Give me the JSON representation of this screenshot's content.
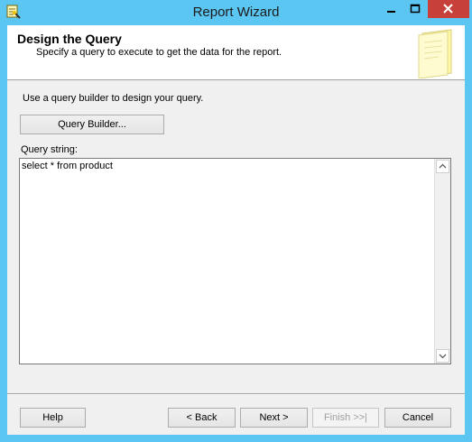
{
  "window": {
    "title": "Report Wizard"
  },
  "header": {
    "title": "Design the Query",
    "subtitle": "Specify a query to execute to get the data for the report."
  },
  "body": {
    "instruction": "Use a query builder to design your query.",
    "query_builder_label": "Query Builder...",
    "query_string_label": "Query string:",
    "query_string_value": "select * from product"
  },
  "footer": {
    "help_label": "Help",
    "back_label": "< Back",
    "next_label": "Next >",
    "finish_label": "Finish >>|",
    "cancel_label": "Cancel"
  },
  "colors": {
    "frame": "#5cc6f2",
    "close": "#c7413a",
    "dialog_bg": "#f0f0f0"
  },
  "icons": [
    "wizard-app-icon",
    "minimize-icon",
    "maximize-icon",
    "close-icon",
    "notepad-icon",
    "scroll-up-icon",
    "scroll-down-icon"
  ]
}
